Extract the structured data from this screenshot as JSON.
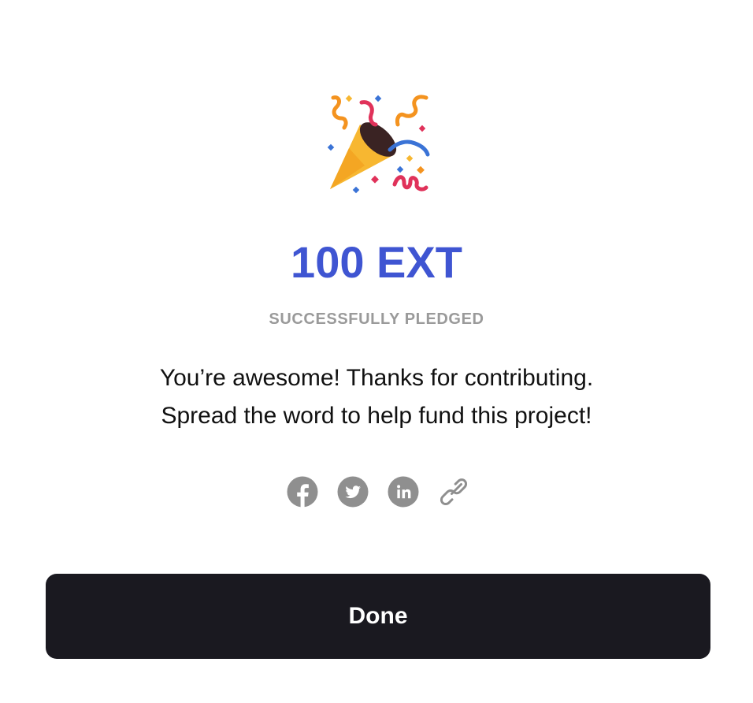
{
  "emoji": {
    "icon": "party-popper-icon"
  },
  "amount_text": "100 EXT",
  "status_text": "SUCCESSFULLY PLEDGED",
  "message": {
    "line1": "You’re awesome! Thanks for contributing.",
    "line2": "Spread the word to help fund this project!"
  },
  "share": [
    {
      "icon": "facebook-icon"
    },
    {
      "icon": "twitter-icon"
    },
    {
      "icon": "linkedin-icon"
    },
    {
      "icon": "link-icon"
    }
  ],
  "done_label": "Done",
  "colors": {
    "accent": "#3f55d2",
    "muted": "#9a9a9a",
    "icon_gray": "#8f8f8f",
    "button_bg": "#1a1920",
    "button_text": "#ffffff"
  }
}
